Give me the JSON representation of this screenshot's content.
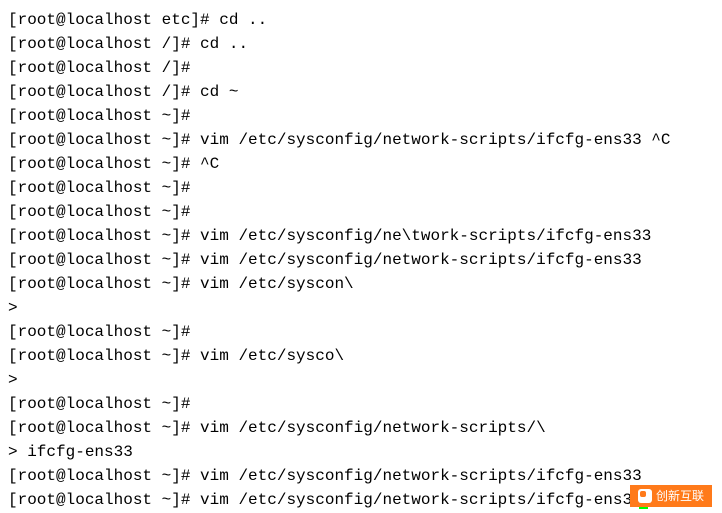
{
  "lines": [
    {
      "prompt": "[root@localhost etc]# ",
      "cmd": "cd .."
    },
    {
      "prompt": "[root@localhost /]# ",
      "cmd": "cd .."
    },
    {
      "prompt": "[root@localhost /]# ",
      "cmd": ""
    },
    {
      "prompt": "[root@localhost /]# ",
      "cmd": "cd ~"
    },
    {
      "prompt": "[root@localhost ~]# ",
      "cmd": ""
    },
    {
      "prompt": "[root@localhost ~]# ",
      "cmd": "vim /etc/sysconfig/network-scripts/ifcfg-ens33 ^C"
    },
    {
      "prompt": "[root@localhost ~]# ",
      "cmd": "^C"
    },
    {
      "prompt": "[root@localhost ~]# ",
      "cmd": ""
    },
    {
      "prompt": "[root@localhost ~]# ",
      "cmd": ""
    },
    {
      "prompt": "[root@localhost ~]# ",
      "cmd": "vim /etc/sysconfig/ne\\twork-scripts/ifcfg-ens33"
    },
    {
      "prompt": "[root@localhost ~]# ",
      "cmd": "vim /etc/sysconfig/network-scripts/ifcfg-ens33"
    },
    {
      "prompt": "[root@localhost ~]# ",
      "cmd": "vim /etc/syscon\\"
    },
    {
      "prompt": "> ",
      "cmd": ""
    },
    {
      "prompt": "[root@localhost ~]# ",
      "cmd": ""
    },
    {
      "prompt": "[root@localhost ~]# ",
      "cmd": "vim /etc/sysco\\"
    },
    {
      "prompt": "> ",
      "cmd": ""
    },
    {
      "prompt": "[root@localhost ~]# ",
      "cmd": ""
    },
    {
      "prompt": "[root@localhost ~]# ",
      "cmd": "vim /etc/sysconfig/network-scripts/\\"
    },
    {
      "prompt": "> ",
      "cmd": "ifcfg-ens33"
    },
    {
      "prompt": "[root@localhost ~]# ",
      "cmd": "vim /etc/sysconfig/network-scripts/ifcfg-ens33"
    },
    {
      "prompt": "[root@localhost ~]# ",
      "cmd": "vim /etc/sysconfig/network-scripts/ifcfg-ens33",
      "cursor": true
    }
  ],
  "watermark": {
    "text": "创新互联"
  }
}
